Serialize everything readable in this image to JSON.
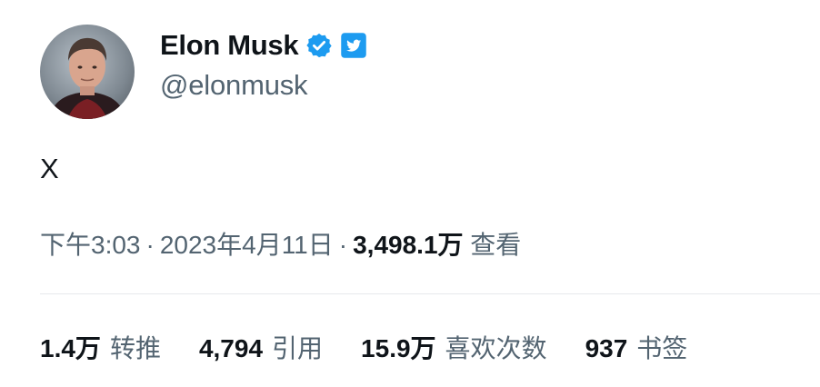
{
  "user": {
    "display_name": "Elon Musk",
    "handle": "@elonmusk",
    "verified_icon": "verified-badge-icon",
    "affiliate_icon": "twitter-bird-icon"
  },
  "tweet": {
    "text": "X"
  },
  "meta": {
    "time": "下午3:03",
    "separator": "·",
    "date": "2023年4月11日",
    "views_count": "3,498.1万",
    "views_label": "查看"
  },
  "stats": [
    {
      "value": "1.4万",
      "label": "转推"
    },
    {
      "value": "4,794",
      "label": "引用"
    },
    {
      "value": "15.9万",
      "label": "喜欢次数"
    },
    {
      "value": "937",
      "label": "书签"
    }
  ],
  "colors": {
    "text_primary": "#0f1419",
    "text_secondary": "#536471",
    "verified_blue": "#1d9bf0",
    "divider": "#e6e9ec"
  }
}
